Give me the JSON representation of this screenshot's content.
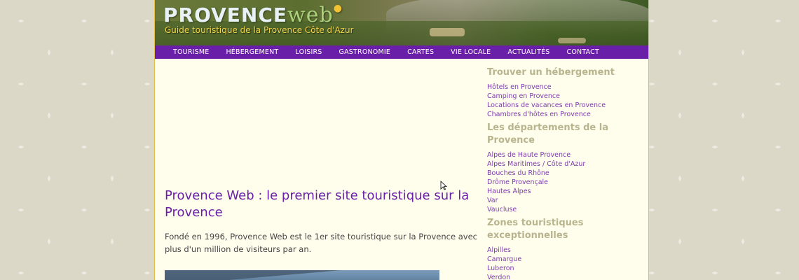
{
  "header": {
    "logo_main": "PROVENCE",
    "logo_web": "web",
    "tagline": "Guide touristique de la Provence Côte d'Azur"
  },
  "nav": {
    "items": [
      "TOURISME",
      "HÉBERGEMENT",
      "LOISIRS",
      "GASTRONOMIE",
      "CARTES",
      "VIE LOCALE",
      "ACTUALITÉS",
      "CONTACT"
    ]
  },
  "main": {
    "title": "Provence Web : le premier site touristique sur la Provence",
    "intro": "Fondé en 1996, Provence Web est le 1er site touristique sur la Provence avec plus d'un million de visiteurs par an."
  },
  "sidebar": {
    "sections": [
      {
        "title": "Trouver un hébergement",
        "links": [
          "Hôtels en Provence",
          "Camping en Provence",
          "Locations de vacances en Provence",
          "Chambres d'hôtes en Provence"
        ]
      },
      {
        "title": "Les départements de la Provence",
        "links": [
          "Alpes de Haute Provence",
          "Alpes Maritimes / Côte d'Azur",
          "Bouches du Rhône",
          "Drôme Provençale",
          "Hautes Alpes",
          "Var",
          "Vaucluse"
        ]
      },
      {
        "title": "Zones touristiques exceptionnelles",
        "links": [
          "Alpilles",
          "Camargue",
          "Luberon",
          "Verdon"
        ]
      }
    ]
  },
  "colors": {
    "nav_bg": "#6a1fa8",
    "link": "#7d3ab0",
    "sidebar_heading": "#b8b58e",
    "content_bg": "#fffeed",
    "page_bg": "#dcd8c8"
  }
}
